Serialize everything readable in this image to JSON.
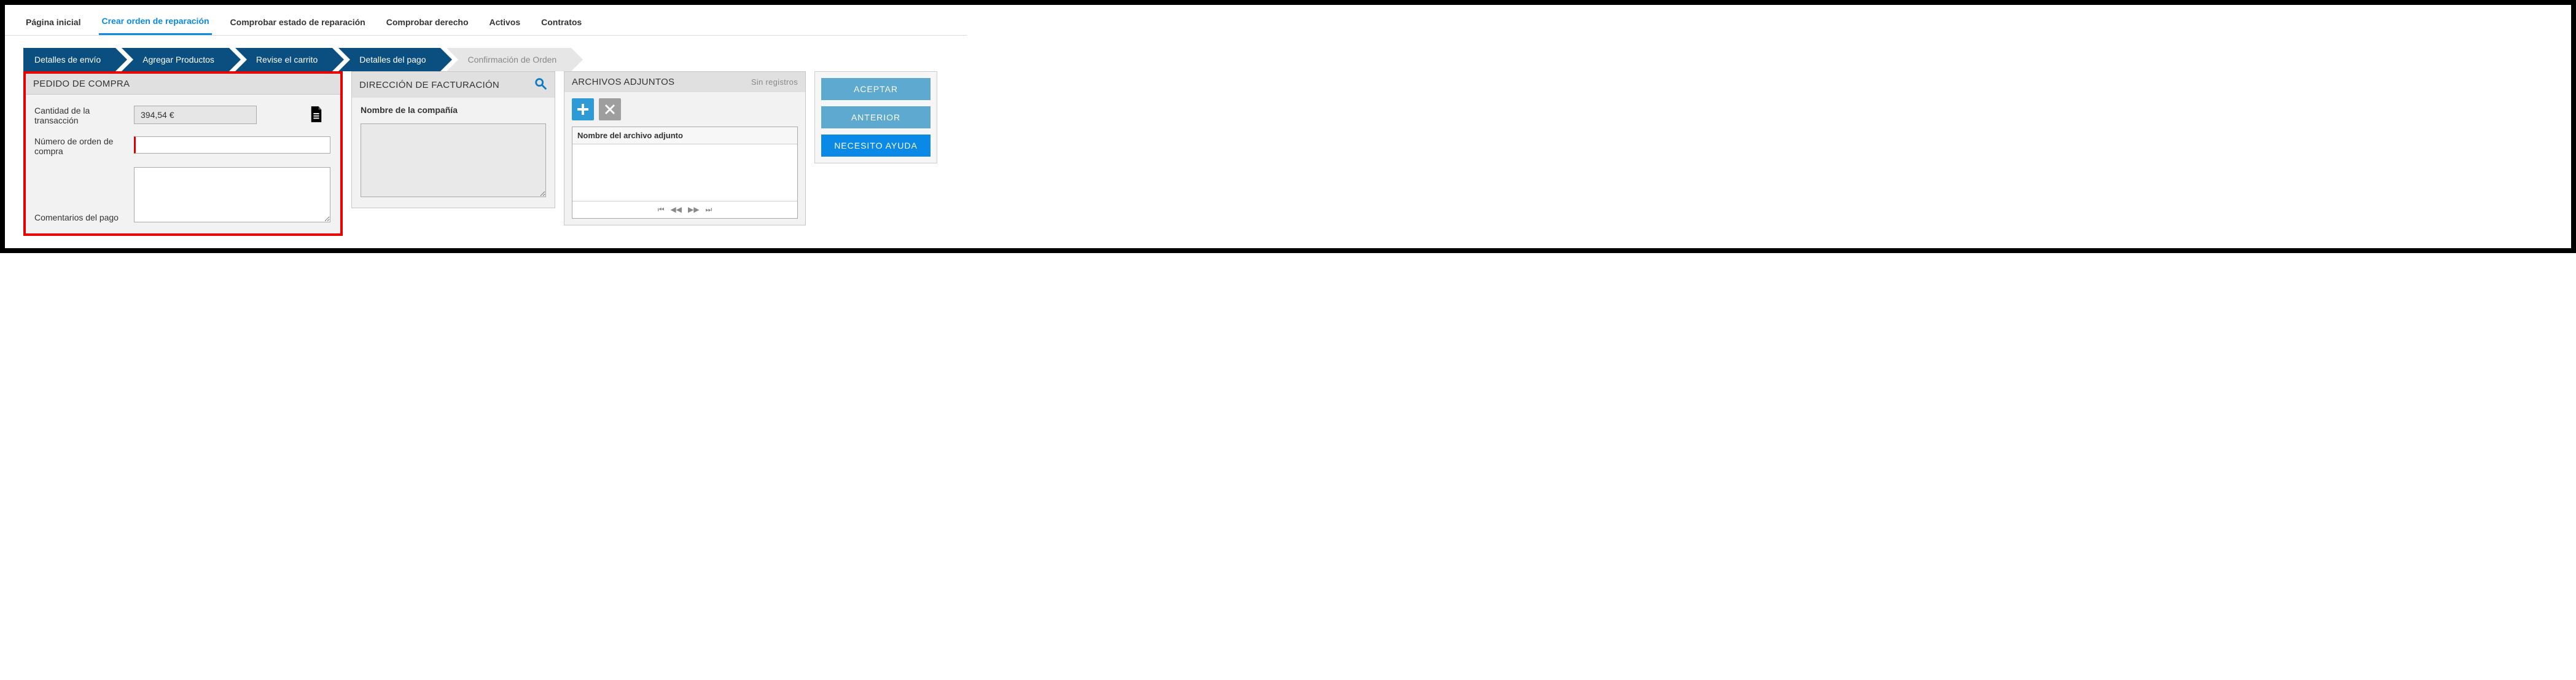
{
  "topTabs": {
    "home": "Página inicial",
    "create": "Crear orden de reparación",
    "check_status": "Comprobar estado de reparación",
    "check_right": "Comprobar derecho",
    "assets": "Activos",
    "contracts": "Contratos"
  },
  "steps": {
    "s1": "Detalles de envío",
    "s2": "Agregar Productos",
    "s3": "Revise el carrito",
    "s4": "Detalles del pago",
    "s5": "Confirmación de Orden"
  },
  "purchase": {
    "title": "PEDIDO DE COMPRA",
    "amount_label": "Cantidad de la transacción",
    "amount_value": "394,54 €",
    "po_label": "Número de orden de compra",
    "po_value": "",
    "comments_label": "Comentarios del pago",
    "comments_value": ""
  },
  "billing": {
    "title": "DIRECCIÓN DE FACTURACIÓN",
    "company_label": "Nombre de la compañía",
    "company_value": ""
  },
  "attachments": {
    "title": "ARCHIVOS ADJUNTOS",
    "empty": "Sin registros",
    "list_header": "Nombre del archivo adjunto"
  },
  "actions": {
    "accept": "ACEPTAR",
    "previous": "ANTERIOR",
    "help": "NECESITO AYUDA"
  }
}
